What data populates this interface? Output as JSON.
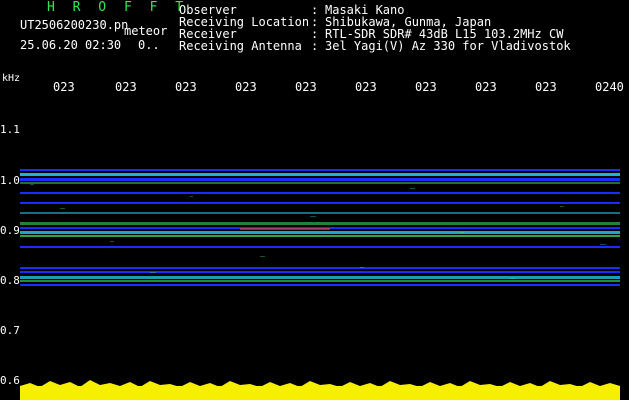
{
  "header": {
    "title": "H R O F F T",
    "file_name": "UT2506200230.pn",
    "mode": "meteor",
    "datetime": "25.06.20 02:30",
    "extra": "0.."
  },
  "meta": {
    "rows": [
      {
        "key": "Observer",
        "value": "Masaki Kano"
      },
      {
        "key": "Receiving Location",
        "value": "Shibukawa, Gunma, Japan"
      },
      {
        "key": "Receiver",
        "value": "RTL-SDR SDR# 43dB L15 103.2MHz CW"
      },
      {
        "key": "Receiving Antenna",
        "value": "3el Yagi(V) Az 330 for Vladivostok"
      }
    ]
  },
  "axes": {
    "unit": "kHz",
    "time_labels": [
      "023",
      "023",
      "023",
      "023",
      "023",
      "023",
      "023",
      "023",
      "023",
      "0240"
    ],
    "freq_labels": [
      "1.1",
      "1.0",
      "0.9",
      "0.8",
      "0.7",
      "0.6"
    ]
  },
  "colors": {
    "background": "#000000",
    "title": "#2eea56",
    "text": "#ffffff",
    "signal_blue": "#1a2cff",
    "signal_cyan": "#2adfff",
    "signal_green": "#47ff66",
    "signal_yellow": "#ffe000",
    "signal_red": "#ff4a2a",
    "baseline_yellow": "#f6ef00"
  }
}
